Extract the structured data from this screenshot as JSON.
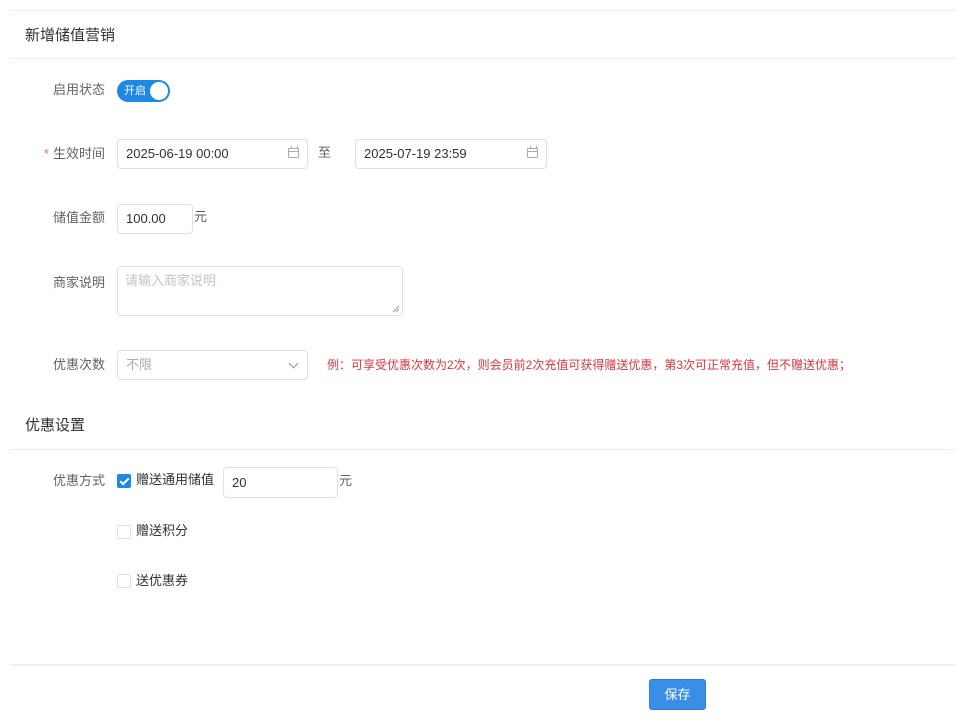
{
  "header": {
    "title": "新增储值营销"
  },
  "form": {
    "status": {
      "label": "启用状态",
      "switch_text": "开启",
      "on": true
    },
    "effective_time": {
      "required_mark": "*",
      "label": "生效时间",
      "start": "2025-06-19 00:00",
      "separator": "至",
      "end": "2025-07-19 23:59"
    },
    "amount": {
      "label": "储值金额",
      "value": "100.00",
      "unit": "元"
    },
    "merchant_note": {
      "label": "商家说明",
      "placeholder": "请输入商家说明"
    },
    "discount_times": {
      "label": "优惠次数",
      "selected": "不限",
      "hint": "例：可享受优惠次数为2次，则会员前2次充值可获得赠送优惠，第3次可正常充值，但不赠送优惠；"
    }
  },
  "discount_section": {
    "title": "优惠设置",
    "method_label": "优惠方式",
    "options": [
      {
        "label": "赠送通用储值",
        "checked": true,
        "value": "20",
        "unit": "元"
      },
      {
        "label": "赠送积分",
        "checked": false
      },
      {
        "label": "送优惠券",
        "checked": false
      }
    ]
  },
  "footer": {
    "save_label": "保存"
  },
  "colors": {
    "primary": "#1e88e5",
    "hint_red": "#d9363e",
    "required_red": "#f56c6c"
  }
}
